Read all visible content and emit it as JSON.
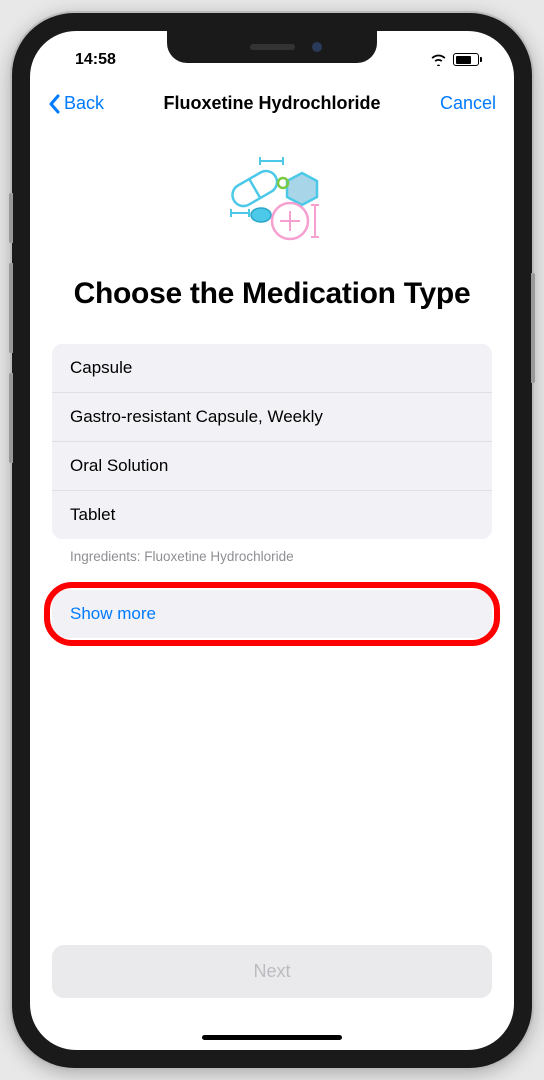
{
  "statusBar": {
    "time": "14:58"
  },
  "navBar": {
    "back": "Back",
    "title": "Fluoxetine Hydrochloride",
    "cancel": "Cancel"
  },
  "pageTitle": "Choose the Medication Type",
  "options": {
    "0": "Capsule",
    "1": "Gastro-resistant Capsule, Weekly",
    "2": "Oral Solution",
    "3": "Tablet"
  },
  "ingredientsLabel": "Ingredients: Fluoxetine Hydrochloride",
  "showMore": "Show more",
  "nextButton": "Next"
}
